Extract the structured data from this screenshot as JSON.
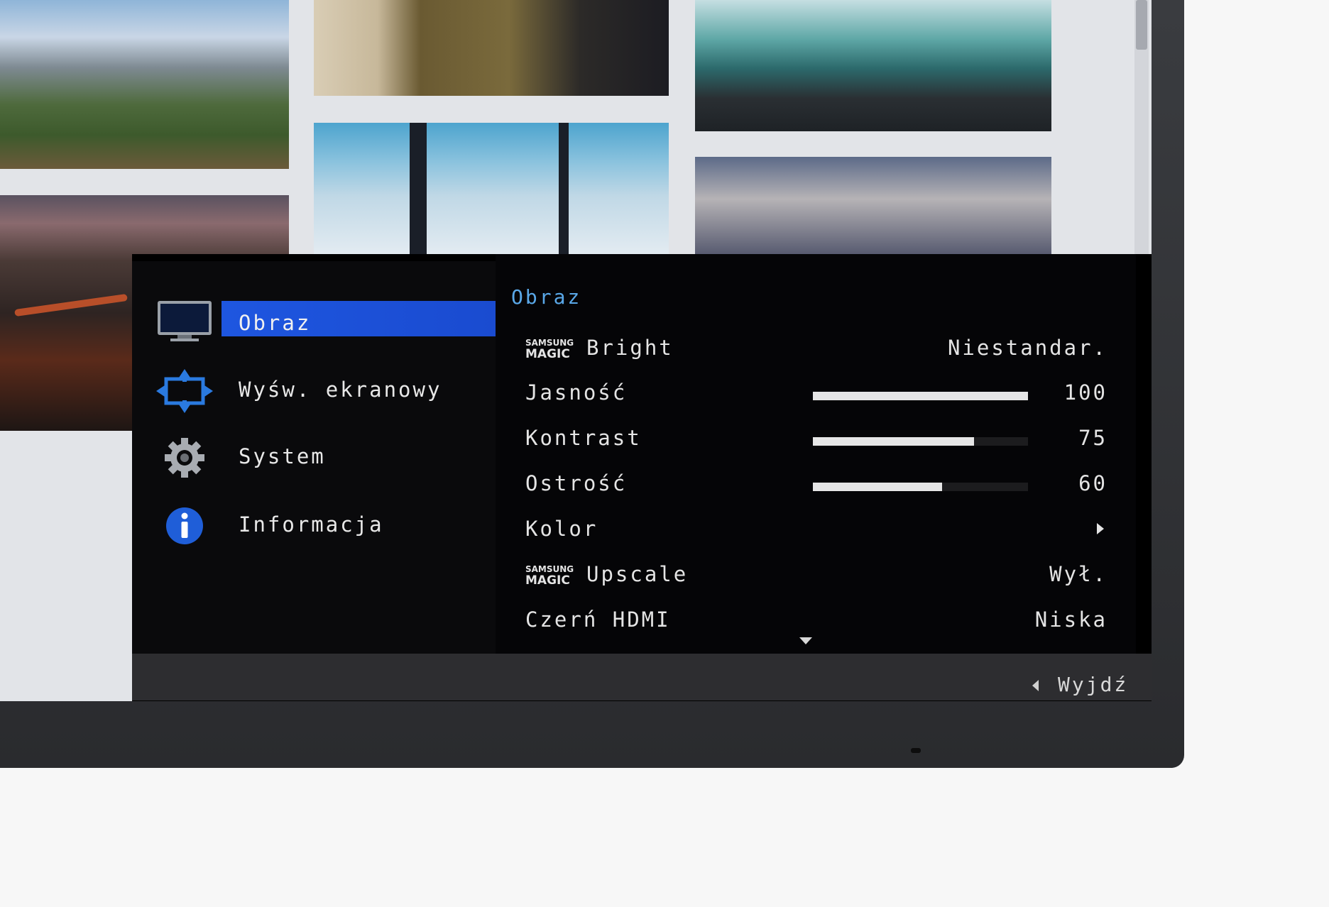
{
  "osd": {
    "menu": [
      {
        "label": "Obraz",
        "icon": "monitor-icon",
        "selected": true
      },
      {
        "label": "Wyśw. ekranowy",
        "icon": "move-arrows-icon"
      },
      {
        "label": "System",
        "icon": "gear-icon"
      },
      {
        "label": "Informacja",
        "icon": "info-icon"
      }
    ],
    "section_title": "Obraz",
    "settings": [
      {
        "brand_top": "SAMSUNG",
        "brand_bottom": "MAGIC",
        "label": "Bright",
        "value": "Niestandar."
      },
      {
        "label": "Jasność",
        "value": "100",
        "level": 1.0
      },
      {
        "label": "Kontrast",
        "value": "75",
        "level": 0.75
      },
      {
        "label": "Ostrość",
        "value": "60",
        "level": 0.6
      },
      {
        "label": "Kolor",
        "value": "",
        "submenu_icon": "chevron-right-icon"
      },
      {
        "brand_top": "SAMSUNG",
        "brand_bottom": "MAGIC",
        "label": "Upscale",
        "value": "Wył."
      },
      {
        "label": "Czerń HDMI",
        "value": "Niska"
      }
    ],
    "exit_label": "Wyjdź"
  },
  "colors": {
    "highlight": "#1e56e0",
    "section_title": "#5aa8e8",
    "text": "#e4e4e4"
  }
}
